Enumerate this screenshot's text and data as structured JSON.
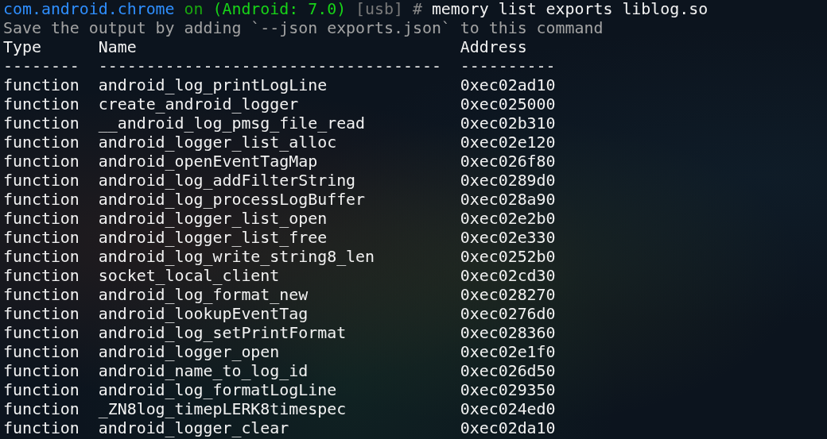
{
  "prompt": {
    "package": "com.android.chrome",
    "connector": "on",
    "device": "(Android: 7.0)",
    "transport": "[usb]",
    "symbol": "#",
    "command": "memory list exports liblog.so"
  },
  "hint": "Save the output by adding `--json exports.json` to this command",
  "table": {
    "columns": [
      "Type",
      "Name",
      "Address"
    ],
    "rules": [
      "--------",
      "------------------------------------",
      "----------"
    ],
    "rows": [
      {
        "type": "function",
        "name": "android_log_printLogLine",
        "address": "0xec02ad10"
      },
      {
        "type": "function",
        "name": "create_android_logger",
        "address": "0xec025000"
      },
      {
        "type": "function",
        "name": "__android_log_pmsg_file_read",
        "address": "0xec02b310"
      },
      {
        "type": "function",
        "name": "android_logger_list_alloc",
        "address": "0xec02e120"
      },
      {
        "type": "function",
        "name": "android_openEventTagMap",
        "address": "0xec026f80"
      },
      {
        "type": "function",
        "name": "android_log_addFilterString",
        "address": "0xec0289d0"
      },
      {
        "type": "function",
        "name": "android_log_processLogBuffer",
        "address": "0xec028a90"
      },
      {
        "type": "function",
        "name": "android_logger_list_open",
        "address": "0xec02e2b0"
      },
      {
        "type": "function",
        "name": "android_logger_list_free",
        "address": "0xec02e330"
      },
      {
        "type": "function",
        "name": "android_log_write_string8_len",
        "address": "0xec0252b0"
      },
      {
        "type": "function",
        "name": "socket_local_client",
        "address": "0xec02cd30"
      },
      {
        "type": "function",
        "name": "android_log_format_new",
        "address": "0xec028270"
      },
      {
        "type": "function",
        "name": "android_lookupEventTag",
        "address": "0xec0276d0"
      },
      {
        "type": "function",
        "name": "android_log_setPrintFormat",
        "address": "0xec028360"
      },
      {
        "type": "function",
        "name": "android_logger_open",
        "address": "0xec02e1f0"
      },
      {
        "type": "function",
        "name": "android_name_to_log_id",
        "address": "0xec026d50"
      },
      {
        "type": "function",
        "name": "android_log_formatLogLine",
        "address": "0xec029350"
      },
      {
        "type": "function",
        "name": "_ZN8log_timepLERK8timespec",
        "address": "0xec024ed0"
      },
      {
        "type": "function",
        "name": "android_logger_clear",
        "address": "0xec02da10"
      }
    ]
  }
}
